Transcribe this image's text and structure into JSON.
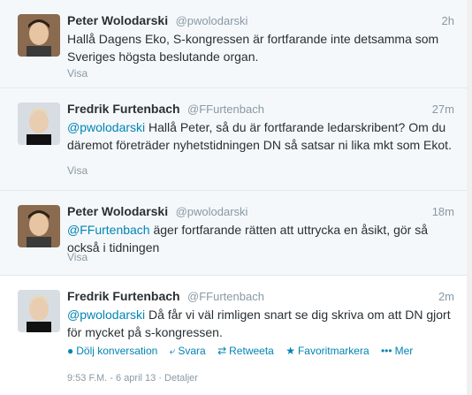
{
  "tweets": [
    {
      "name": "Peter Wolodarski",
      "handle": "@pwolodarski",
      "time": "2h",
      "text": "Hallå Dagens Eko, S-kongressen är fortfarande inte detsamma som Sveriges högsta beslutande organ.",
      "show_label": "Visa"
    },
    {
      "name": "Fredrik Furtenbach",
      "handle": "@FFurtenbach",
      "time": "27m",
      "mention": "@pwolodarski",
      "text": " Hallå Peter, så du är fortfarande ledarskribent? Om du däremot företräder nyhetstidningen DN så satsar ni lika mkt som Ekot.",
      "show_label": "Visa"
    },
    {
      "name": "Peter Wolodarski",
      "handle": "@pwolodarski",
      "time": "18m",
      "mention": "@FFurtenbach",
      "text": " äger fortfarande rätten att uttrycka en åsikt, gör så också i tidningen",
      "show_label": "Visa"
    },
    {
      "name": "Fredrik Furtenbach",
      "handle": "@FFurtenbach",
      "time": "2m",
      "mention": "@pwolodarski",
      "text": " Då får vi väl rimligen snart se dig skriva om att DN gjort för mycket på s-kongressen.",
      "actions": {
        "hide": "Dölj konversation",
        "reply": "Svara",
        "retweet": "Retweeta",
        "favorite": "Favoritmarkera",
        "more": "Mer"
      },
      "meta": "9:53 F.M. - 6 april 13 · Detaljer"
    }
  ],
  "colors": {
    "link": "#0084b4",
    "text": "#292f33",
    "muted": "#8899a6",
    "bg_alt": "#f5f8fa"
  },
  "icons": {
    "hide": "speech-bubble-icon",
    "reply": "reply-arrow-icon",
    "retweet": "retweet-icon",
    "favorite": "star-icon",
    "more": "dots-icon"
  }
}
